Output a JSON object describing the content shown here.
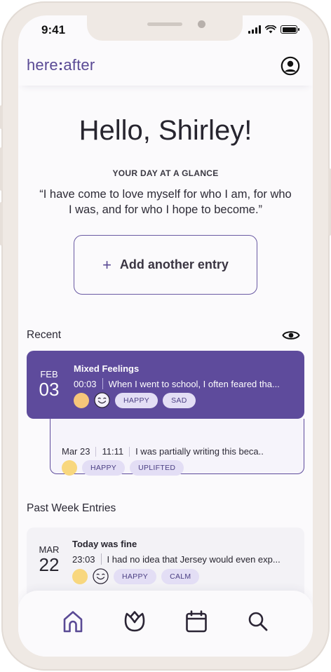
{
  "status_bar": {
    "time": "9:41"
  },
  "header": {
    "logo_left": "here",
    "logo_colon": ":",
    "logo_right": "after"
  },
  "greeting": "Hello, Shirley!",
  "glance_label": "YOUR DAY AT A GLANCE",
  "quote": "“I have come to love myself for who I am, for who I was, and for who I hope to become.”",
  "add_entry": {
    "icon": "+",
    "label": "Add another entry"
  },
  "recent": {
    "title": "Recent",
    "featured": {
      "month": "FEB",
      "day": "03",
      "title": "Mixed Feelings",
      "time": "00:03",
      "excerpt": "When I went to school, I often feared tha...",
      "tags": [
        "HAPPY",
        "SAD"
      ]
    },
    "sub": {
      "date": "Mar 23",
      "time": "11:11",
      "excerpt": "I was partially writing this beca..",
      "tags": [
        "HAPPY",
        "UPLIFTED"
      ]
    }
  },
  "past_week": {
    "title": "Past Week Entries",
    "entries": [
      {
        "month": "MAR",
        "day": "22",
        "title": "Today was fine",
        "time": "23:03",
        "excerpt": "I had no idea that Jersey would even exp...",
        "tags": [
          "HAPPY",
          "CALM"
        ]
      }
    ]
  },
  "nav": [
    "home-icon",
    "lotus-icon",
    "calendar-icon",
    "search-icon"
  ],
  "colors": {
    "accent": "#5e4b9c",
    "tag_bg": "#e3def5",
    "mood_yellow": "#f8d77e",
    "mood_orange": "#f6c67a"
  }
}
